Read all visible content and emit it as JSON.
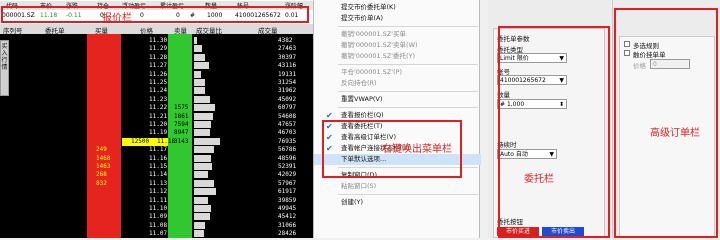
{
  "header": {
    "labels": [
      "代码",
      "市价",
      "涨跌",
      "持仓",
      "浮动盈亏",
      "累计盈亏",
      "数量",
      "帐号",
      "涨阶幅"
    ],
    "values": [
      "000001.SZ",
      "11.18",
      "-0.11",
      "0",
      "0",
      "0",
      "1000",
      "410001265672",
      "0.01"
    ],
    "hash": "#"
  },
  "toolbar": {
    "labels": [
      "序列号",
      "委托单",
      "买量",
      "价格",
      "卖量",
      "成交量比",
      "成交量"
    ]
  },
  "side_button": "买入行情",
  "book": [
    {
      "price": "11.30",
      "buy": "",
      "sell": "",
      "trade": "4382",
      "bar": 0.1
    },
    {
      "price": "11.29",
      "buy": "",
      "sell": "",
      "trade": "27463",
      "bar": 0.28
    },
    {
      "price": "11.28",
      "buy": "",
      "sell": "",
      "trade": "30397",
      "bar": 0.38
    },
    {
      "price": "11.27",
      "buy": "",
      "sell": "",
      "trade": "43116",
      "bar": 0.5
    },
    {
      "price": "11.26",
      "buy": "",
      "sell": "",
      "trade": "19131",
      "bar": 0.22
    },
    {
      "price": "11.25",
      "buy": "",
      "sell": "",
      "trade": "31254",
      "bar": 0.36
    },
    {
      "price": "11.24",
      "buy": "",
      "sell": "",
      "trade": "31962",
      "bar": 0.37
    },
    {
      "price": "11.23",
      "buy": "",
      "sell": "",
      "trade": "45092",
      "bar": 0.52
    },
    {
      "price": "11.22",
      "buy": "",
      "sell": "1575",
      "trade": "60797",
      "bar": 0.7
    },
    {
      "price": "11.21",
      "buy": "",
      "sell": "1861",
      "trade": "54608",
      "bar": 0.63
    },
    {
      "price": "11.20",
      "buy": "",
      "sell": "7594",
      "trade": "47657",
      "bar": 0.55
    },
    {
      "price": "11.19",
      "buy": "",
      "sell": "8947",
      "trade": "46703",
      "bar": 0.54
    },
    {
      "price": "11.18",
      "buy": "",
      "sell": "3143",
      "trade": "76935",
      "bar": 0.88,
      "highlight": true,
      "lhs": "12500"
    },
    {
      "price": "11.17",
      "buy": "249",
      "sell": "",
      "trade": "56786",
      "bar": 0.66
    },
    {
      "price": "11.16",
      "buy": "1468",
      "sell": "",
      "trade": "48596",
      "bar": 0.56
    },
    {
      "price": "11.15",
      "buy": "1463",
      "sell": "",
      "trade": "52391",
      "bar": 0.6
    },
    {
      "price": "11.14",
      "buy": "268",
      "sell": "",
      "trade": "42029",
      "bar": 0.48
    },
    {
      "price": "11.13",
      "buy": "832",
      "sell": "",
      "trade": "57967",
      "bar": 0.66
    },
    {
      "price": "11.12",
      "buy": "",
      "sell": "",
      "trade": "61917",
      "bar": 0.72
    },
    {
      "price": "11.11",
      "buy": "",
      "sell": "",
      "trade": "39859",
      "bar": 0.46
    },
    {
      "price": "11.10",
      "buy": "",
      "sell": "",
      "trade": "49945",
      "bar": 0.58
    },
    {
      "price": "11.09",
      "buy": "",
      "sell": "",
      "trade": "45412",
      "bar": 0.52
    },
    {
      "price": "11.08",
      "buy": "",
      "sell": "",
      "trade": "31066",
      "bar": 0.36
    },
    {
      "price": "11.07",
      "buy": "",
      "sell": "",
      "trade": "28426",
      "bar": 0.33
    }
  ],
  "menu": {
    "items": [
      {
        "label": "提交市价委托单(K)",
        "kind": "normal"
      },
      {
        "label": "提交市价单(A)",
        "kind": "normal"
      },
      {
        "sep": true
      },
      {
        "label": "撤销'000001.SZ'买单",
        "kind": "dis"
      },
      {
        "label": "撤销'000001.SZ'卖单(W)",
        "kind": "dis"
      },
      {
        "label": "撤销'000001.SZ'委托(Y)",
        "kind": "dis"
      },
      {
        "sep": true
      },
      {
        "label": "平仓'000001.SZ'(P)",
        "kind": "dis"
      },
      {
        "label": "反向持仓(R)",
        "kind": "dis"
      },
      {
        "sep": true
      },
      {
        "label": "重置VWAP(V)",
        "kind": "normal"
      },
      {
        "sep": true
      },
      {
        "label": "查看报价栏(Q)",
        "kind": "check"
      },
      {
        "label": "查看委托栏(T)",
        "kind": "check"
      },
      {
        "label": "查看高级订单栏(V)",
        "kind": "check"
      },
      {
        "label": "查看帐户连接状态栏(U)",
        "kind": "check"
      },
      {
        "label": "下单默认选项...",
        "kind": "sel"
      },
      {
        "sep": true
      },
      {
        "label": "复制窗口(D)",
        "kind": "normal"
      },
      {
        "label": "粘贴窗口(S)",
        "kind": "dis"
      },
      {
        "sep": true
      },
      {
        "label": "创建(Y)",
        "kind": "normal"
      }
    ]
  },
  "order": {
    "section_title": "委托单参数",
    "type_label": "委托类型",
    "type_value": "Limit 限价",
    "account_label": "帐号",
    "account_value": "410001265672",
    "qty_label": "数量",
    "qty_prefix": "#",
    "qty_value": "1,000",
    "tif_label": "持续时",
    "tif_value": "Auto 自动",
    "btn_section": "委托按钮",
    "buy_label": "市价买进",
    "sell_label": "市价卖出"
  },
  "advanced": {
    "cb1": "多选规则",
    "cb2": "触价挂单单",
    "price_label": "价格",
    "price_value": "0"
  },
  "annotations": {
    "quote": "报价栏",
    "menu": "右键唤出菜单栏",
    "order": "委托栏",
    "advanced": "高级订单栏"
  },
  "colors": {
    "buy_col": "#e52420",
    "sell_col": "#2fc82f",
    "annot": "#e02020",
    "buy_btn": "#d81e1e",
    "sell_btn": "#1e4ad8"
  }
}
